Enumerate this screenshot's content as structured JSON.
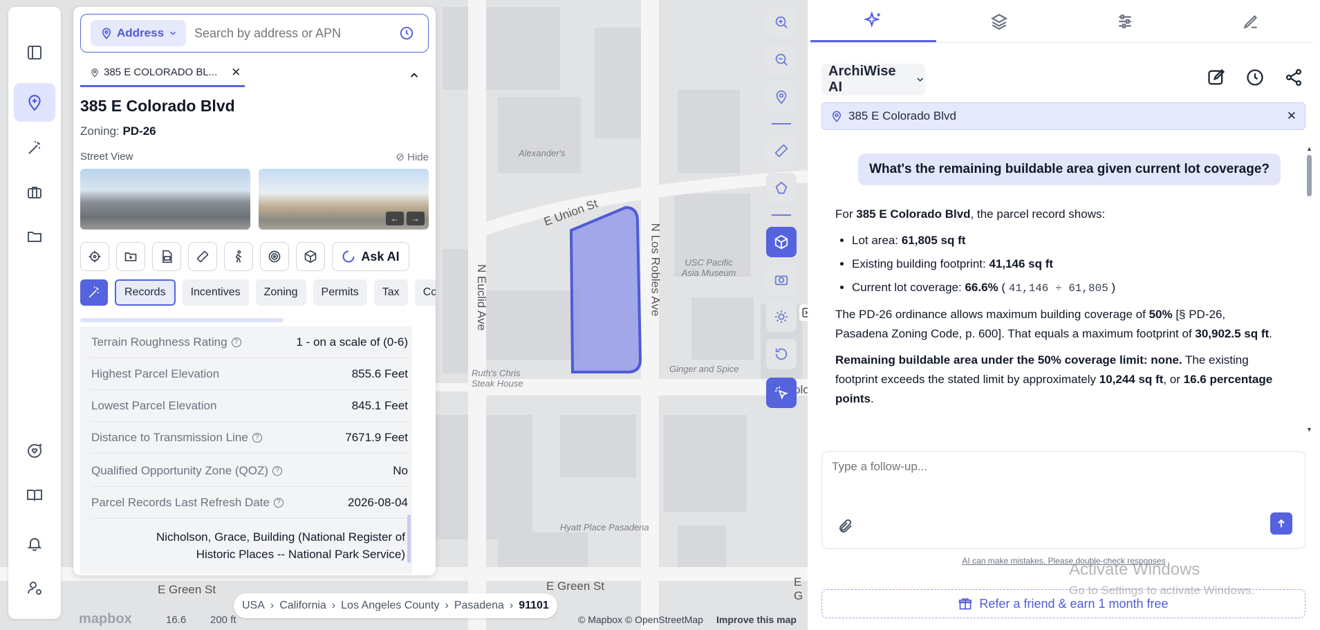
{
  "panel": {
    "address_chip": "Address",
    "search_placeholder": "Search by address or APN",
    "tab_label": "385 E COLORADO BL...",
    "title": "385 E Colorado Blvd",
    "zoning_label": "Zoning:",
    "zoning_value": "PD-26",
    "street_view_label": "Street View",
    "hide_label": "Hide",
    "ask_ai": "Ask AI",
    "categories": [
      "Records",
      "Incentives",
      "Zoning",
      "Permits",
      "Tax",
      "Com"
    ],
    "rows": [
      {
        "label": "Terrain Roughness Rating",
        "value": "1 - on a scale of (0-6)",
        "help": true
      },
      {
        "label": "Highest Parcel Elevation",
        "value": "855.6 Feet",
        "help": false
      },
      {
        "label": "Lowest Parcel Elevation",
        "value": "845.1 Feet",
        "help": false
      },
      {
        "label": "Distance to Transmission Line",
        "value": "7671.9 Feet",
        "help": true
      },
      {
        "label": "Qualified Opportunity Zone (QOZ)",
        "value": "No",
        "help": true
      },
      {
        "label": "Parcel Records Last Refresh Date",
        "value": "2026-08-04",
        "help": true
      }
    ],
    "historic": "Nicholson, Grace, Building (National Register of Historic Places -- National Park Service)"
  },
  "map": {
    "streets": [
      "E Union St",
      "N Euclid Ave",
      "N Los Robles Ave",
      "E Green St",
      "E Green St",
      "E G",
      "olo"
    ],
    "places": [
      "Alexander's",
      "USC Pacific Asia Museum",
      "Ruth's Chris Steak House",
      "Ginger and Spice",
      "Hyatt Place Pasadena"
    ],
    "breadcrumb": [
      "USA",
      "California",
      "Los Angeles County",
      "Pasadena",
      "91101"
    ],
    "zoom": "16.6",
    "scale": "200 ft",
    "logo": "mapbox",
    "attribution": "© Mapbox © OpenStreetMap",
    "improve": "Improve this map",
    "arrow_prev": "←",
    "arrow_next": "→"
  },
  "right": {
    "model": "ArchiWise AI",
    "location": "385 E Colorado Blvd",
    "question": "What's the remaining buildable area given current lot coverage?",
    "intro_pre": "For ",
    "intro_bold": "385 E Colorado Blvd",
    "intro_post": ", the parcel record shows:",
    "b1_label": "Lot area: ",
    "b1_value": "61,805 sq ft",
    "b2_label": "Existing building footprint: ",
    "b2_value": "41,146 sq ft",
    "b3_label": "Current lot coverage: ",
    "b3_value": "66.6%",
    "b3_formula": "41,146 ÷ 61,805",
    "p1_a": "The PD-26 ordinance allows maximum building coverage of ",
    "p1_b": "50%",
    "p1_c": " [§ PD-26, Pasadena Zoning Code, p. 600]. That equals a maximum footprint of ",
    "p1_d": "30,902.5 sq ft",
    "p1_e": ".",
    "p2_a": "Remaining buildable area under the 50% coverage limit: none.",
    "p2_b": " The existing footprint exceeds the stated limit by approximately ",
    "p2_c": "10,244 sq ft",
    "p2_d": ", or ",
    "p2_e": "16.6 percentage points",
    "p2_f": ".",
    "input_placeholder": "Type a follow-up...",
    "disclaimer": "AI can make mistakes. Please double-check responses",
    "refer": "Refer a friend & earn 1 month free",
    "watermark_title": "Activate Windows",
    "watermark_sub": "Go to Settings to activate Windows."
  }
}
